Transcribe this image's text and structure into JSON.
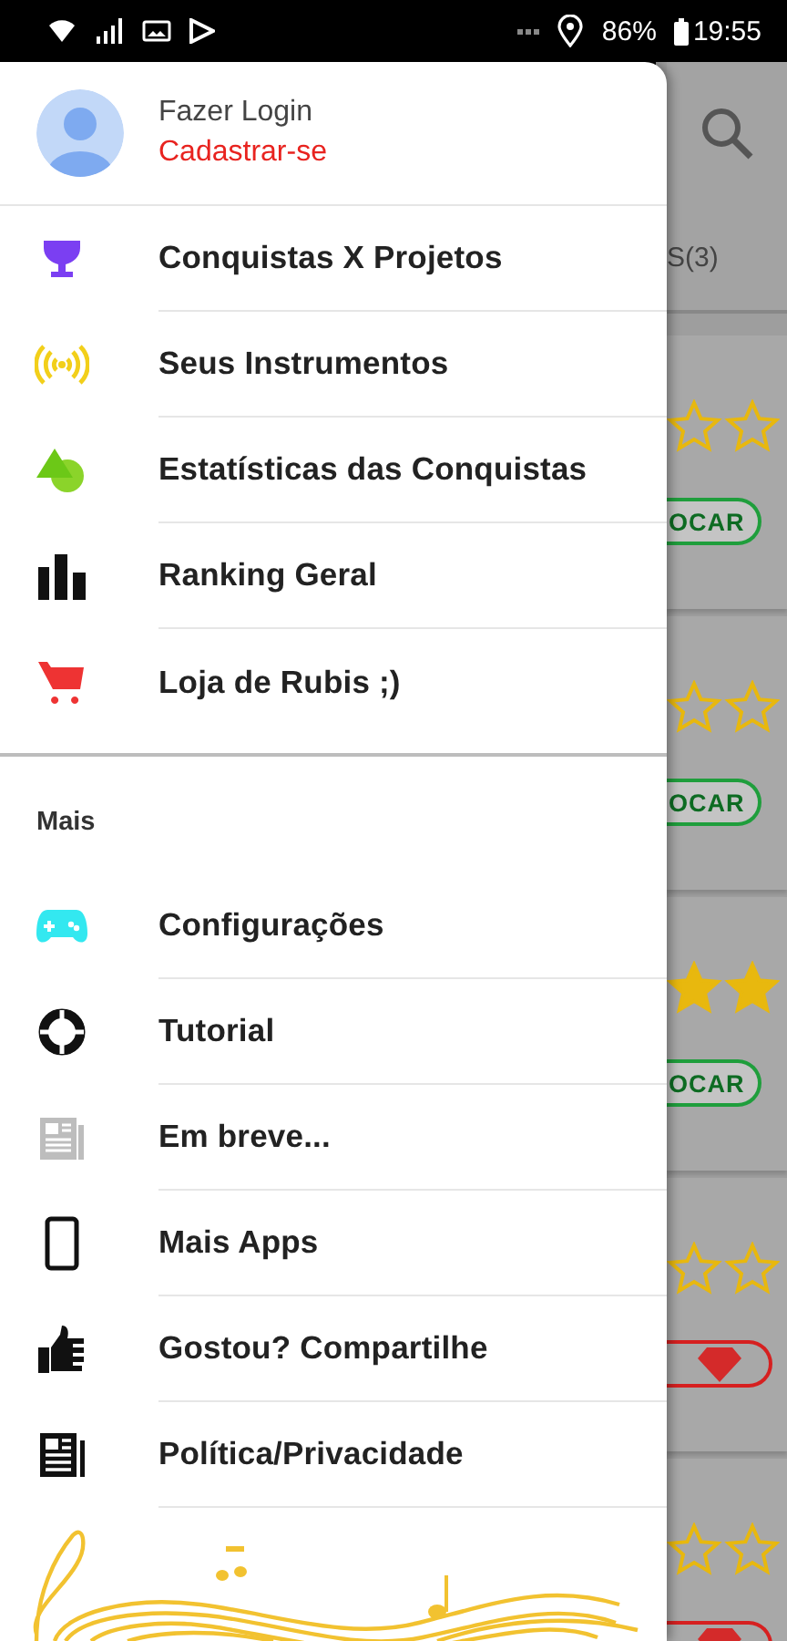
{
  "status_bar": {
    "battery": "86%",
    "time": "19:55"
  },
  "drawer": {
    "header": {
      "title": "Fazer Login",
      "subtitle": "Cadastrar-se"
    },
    "main_items": [
      {
        "label": "Conquistas X Projetos"
      },
      {
        "label": "Seus Instrumentos"
      },
      {
        "label": "Estatísticas das Conquistas"
      },
      {
        "label": "Ranking Geral"
      },
      {
        "label": "Loja de Rubis ;)"
      }
    ],
    "section_title": "Mais",
    "more_items": [
      {
        "label": "Configurações"
      },
      {
        "label": "Tutorial"
      },
      {
        "label": "Em breve..."
      },
      {
        "label": "Mais Apps"
      },
      {
        "label": "Gostou? Compartilhe"
      },
      {
        "label": "Política/Privacidade"
      }
    ]
  },
  "background": {
    "tab_label": "S(3)",
    "cards": [
      {
        "star_icons": [
          {
            "filled": false
          },
          {
            "filled": false
          }
        ],
        "kind": "play",
        "button": "OCAR"
      },
      {
        "star_icons": [
          {
            "filled": false
          },
          {
            "filled": false
          }
        ],
        "kind": "play",
        "button": "OCAR"
      },
      {
        "star_icons": [
          {
            "filled": true
          },
          {
            "filled": true
          }
        ],
        "kind": "play",
        "button": "OCAR"
      },
      {
        "star_icons": [
          {
            "filled": false
          },
          {
            "filled": false
          }
        ],
        "kind": "ruby"
      },
      {
        "star_icons": [
          {
            "filled": false
          },
          {
            "filled": false
          }
        ],
        "kind": "ruby"
      }
    ]
  }
}
